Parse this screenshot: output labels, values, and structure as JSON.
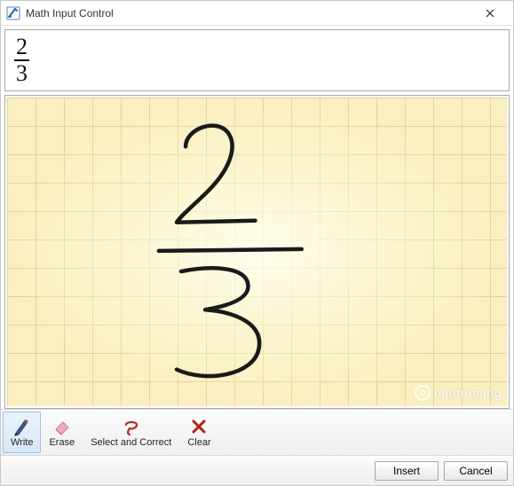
{
  "window": {
    "title": "Math Input Control"
  },
  "preview": {
    "numerator": "2",
    "denominator": "3"
  },
  "canvas": {
    "ink_description": "handwritten fraction 2 over 3"
  },
  "watermark": {
    "text": "uantrimang"
  },
  "toolbar": {
    "items": [
      {
        "id": "write",
        "label": "Write",
        "icon": "pencil-icon",
        "active": true
      },
      {
        "id": "erase",
        "label": "Erase",
        "icon": "eraser-icon",
        "active": false
      },
      {
        "id": "select",
        "label": "Select and Correct",
        "icon": "lasso-icon",
        "active": false
      },
      {
        "id": "clear",
        "label": "Clear",
        "icon": "x-icon",
        "active": false
      }
    ]
  },
  "buttons": {
    "insert": "Insert",
    "cancel": "Cancel"
  }
}
